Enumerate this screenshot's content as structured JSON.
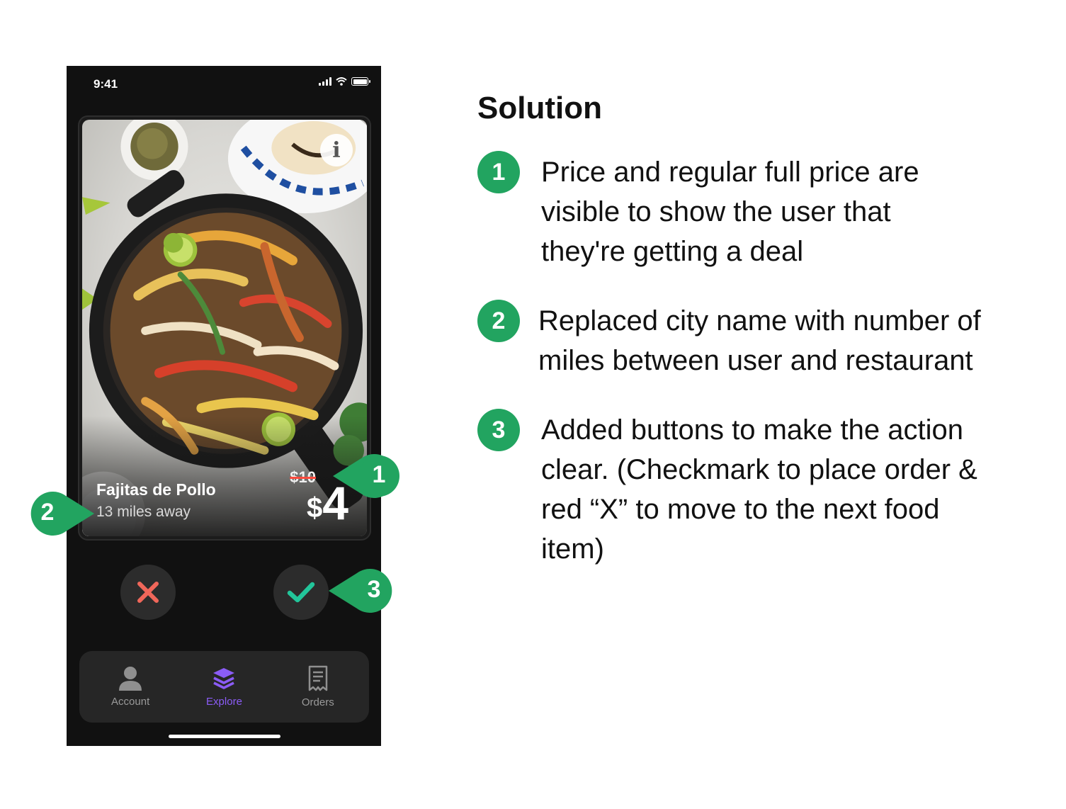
{
  "phone": {
    "status_time": "9:41",
    "card": {
      "dish_name": "Fajitas de Pollo",
      "distance": "13 miles away",
      "original_price": "$10",
      "price_currency": "$",
      "price_amount": "4",
      "info_icon_label": "i"
    },
    "actions": [
      {
        "name": "reject",
        "icon": "x-icon",
        "color": "#f0675a"
      },
      {
        "name": "accept",
        "icon": "check-icon",
        "color": "#22c59a"
      }
    ],
    "tabs": [
      {
        "label": "Account",
        "icon": "person-icon",
        "active": false
      },
      {
        "label": "Explore",
        "icon": "layers-icon",
        "active": true
      },
      {
        "label": "Orders",
        "icon": "receipt-icon",
        "active": false
      }
    ],
    "accent_color": "#8b5cf6"
  },
  "callouts": [
    {
      "number": "1"
    },
    {
      "number": "2"
    },
    {
      "number": "3"
    }
  ],
  "solution": {
    "title": "Solution",
    "points": [
      {
        "number": "1",
        "lines": [
          "Price and regular full price are",
          "visible to show the user that",
          "they're getting a deal"
        ]
      },
      {
        "number": "2",
        "lines": [
          "Replaced city name with number of",
          "miles between user and restaurant"
        ]
      },
      {
        "number": "3",
        "lines": [
          "Added buttons to make the action",
          "clear. (Checkmark to place order &",
          "red “X” to move to the next food",
          "item)"
        ]
      }
    ]
  },
  "badge_color": "#22a460"
}
